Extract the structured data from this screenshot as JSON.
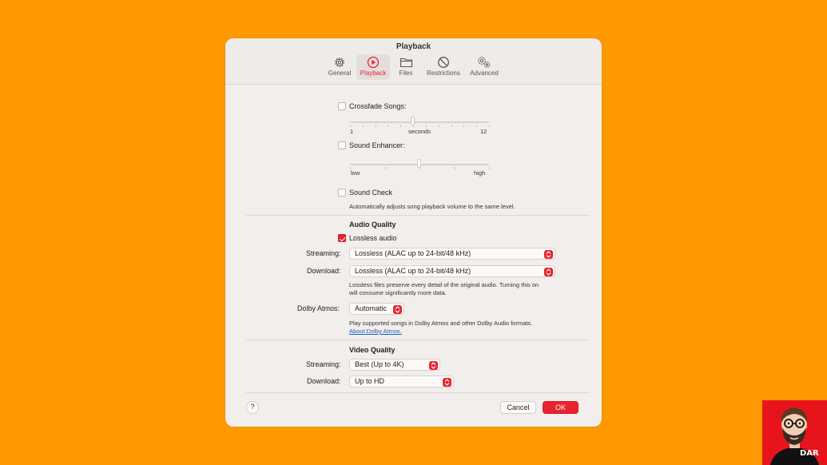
{
  "window": {
    "title": "Playback"
  },
  "tabs": [
    {
      "label": "General",
      "icon": "gear-icon"
    },
    {
      "label": "Playback",
      "icon": "play-circle-icon",
      "active": true
    },
    {
      "label": "Files",
      "icon": "folder-icon"
    },
    {
      "label": "Restrictions",
      "icon": "prohibited-icon"
    },
    {
      "label": "Advanced",
      "icon": "gears-icon"
    }
  ],
  "crossfade": {
    "label": "Crossfade Songs:",
    "checked": false,
    "min_label": "1",
    "unit_label": "seconds",
    "max_label": "12",
    "value": 6
  },
  "sound_enhancer": {
    "label": "Sound Enhancer:",
    "checked": false,
    "min_label": "low",
    "max_label": "high",
    "value_fraction": 0.5
  },
  "sound_check": {
    "label": "Sound Check",
    "checked": false,
    "description": "Automatically adjusts song playback volume to the same level."
  },
  "audio_quality": {
    "heading": "Audio Quality",
    "lossless_label": "Lossless audio",
    "lossless_checked": true,
    "streaming_label": "Streaming:",
    "streaming_value": "Lossless (ALAC up to 24-bit/48 kHz)",
    "download_label": "Download:",
    "download_value": "Lossless (ALAC up to 24-bit/48 kHz)",
    "note_line1": "Lossless files preserve every detail of the original audio. Turning this on",
    "note_line2": "will consume significantly more data.",
    "dolby_label": "Dolby Atmos:",
    "dolby_value": "Automatic",
    "dolby_note": "Play supported songs in Dolby Atmos and other Dolby Audio formats.",
    "dolby_link": "About Dolby Atmos."
  },
  "video_quality": {
    "heading": "Video Quality",
    "streaming_label": "Streaming:",
    "streaming_value": "Best (Up to 4K)",
    "download_label": "Download:",
    "download_value": "Up to HD"
  },
  "footer": {
    "help_label": "?",
    "cancel_label": "Cancel",
    "ok_label": "OK"
  },
  "watermark": {
    "text": "DAR"
  },
  "colors": {
    "background": "#ff9900",
    "accent": "#e8232e"
  }
}
